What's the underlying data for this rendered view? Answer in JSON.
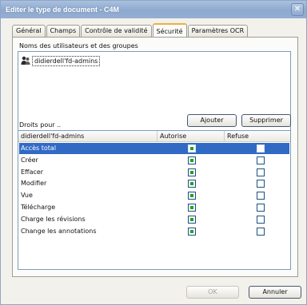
{
  "window": {
    "title": "Editer le type de document - C4M",
    "close_glyph": "✕"
  },
  "tabs": [
    {
      "label": "Général",
      "active": false
    },
    {
      "label": "Champs",
      "active": false
    },
    {
      "label": "Contrôle de validité",
      "active": false
    },
    {
      "label": "Sécurité",
      "active": true
    },
    {
      "label": "Paramètres OCR",
      "active": false
    }
  ],
  "users": {
    "label": "Noms des utilisateurs et des groupes",
    "items": [
      {
        "name": "didierdell'fd-admins",
        "icon": "user-group-icon"
      }
    ],
    "add_button": "Ajouter",
    "remove_button": "Supprimer"
  },
  "rights": {
    "label": "Droits pour ..",
    "columns": {
      "name": "didierdell'fd-admins",
      "allow": "Autorise",
      "deny": "Refuse"
    },
    "rows": [
      {
        "label": "Accès total",
        "allow": true,
        "deny": false,
        "selected": true
      },
      {
        "label": "Créer",
        "allow": true,
        "deny": false,
        "selected": false
      },
      {
        "label": "Effacer",
        "allow": true,
        "deny": false,
        "selected": false
      },
      {
        "label": "Modifier",
        "allow": true,
        "deny": false,
        "selected": false
      },
      {
        "label": "Vue",
        "allow": true,
        "deny": false,
        "selected": false
      },
      {
        "label": "Télécharge",
        "allow": true,
        "deny": false,
        "selected": false
      },
      {
        "label": "Charge les révisions",
        "allow": true,
        "deny": false,
        "selected": false
      },
      {
        "label": "Change les annotations",
        "allow": true,
        "deny": false,
        "selected": false
      }
    ]
  },
  "footer": {
    "ok_label": "OK",
    "ok_enabled": false,
    "cancel_label": "Annuler"
  },
  "colors": {
    "selection": "#316ac5",
    "check_fill": "#21a121",
    "title_bar": "#8ea9cf"
  }
}
